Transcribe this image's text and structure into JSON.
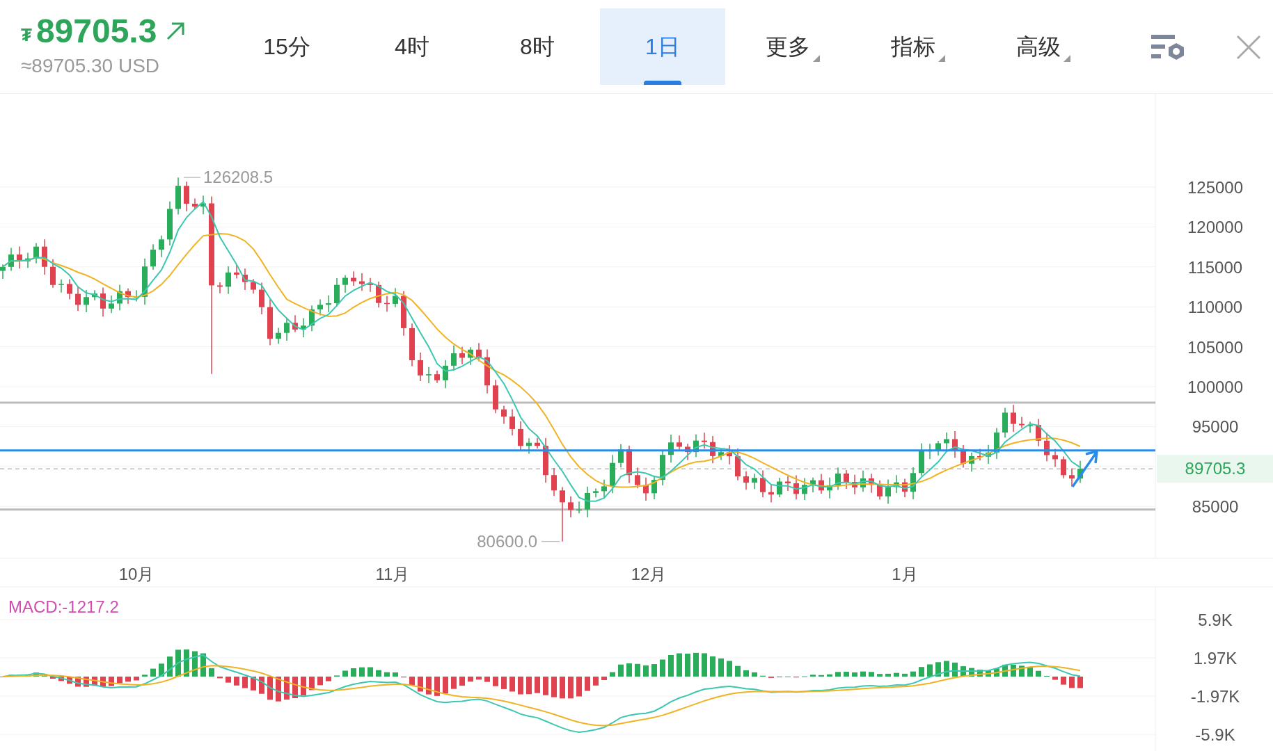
{
  "header": {
    "currency_symbol": "₮",
    "price": "89705.3",
    "fiat": "≈89705.30 USD"
  },
  "tabs": [
    {
      "label": "15分",
      "selected": false,
      "kind": "plain"
    },
    {
      "label": "4时",
      "selected": false,
      "kind": "plain"
    },
    {
      "label": "8时",
      "selected": false,
      "kind": "plain"
    },
    {
      "label": "1日",
      "selected": true,
      "kind": "plain"
    },
    {
      "label": "更多",
      "selected": false,
      "kind": "dropdown"
    },
    {
      "label": "指标",
      "selected": false,
      "kind": "dropdown"
    },
    {
      "label": "高级",
      "selected": false,
      "kind": "dropdown"
    }
  ],
  "chart": {
    "y_axis_labels": [
      "125000",
      "120000",
      "115000",
      "110000",
      "105000",
      "100000",
      "95000",
      "85000"
    ],
    "high_label": "126208.5",
    "low_label": "80600.0",
    "current_price_tag": "89705.3",
    "x_axis_labels": [
      "10月",
      "11月",
      "12月",
      "1月"
    ]
  },
  "macd": {
    "legend": "MACD:-1217.2",
    "axis_labels": [
      "5.9K",
      "1.97K",
      "-1.97K",
      "-5.9K"
    ]
  }
}
